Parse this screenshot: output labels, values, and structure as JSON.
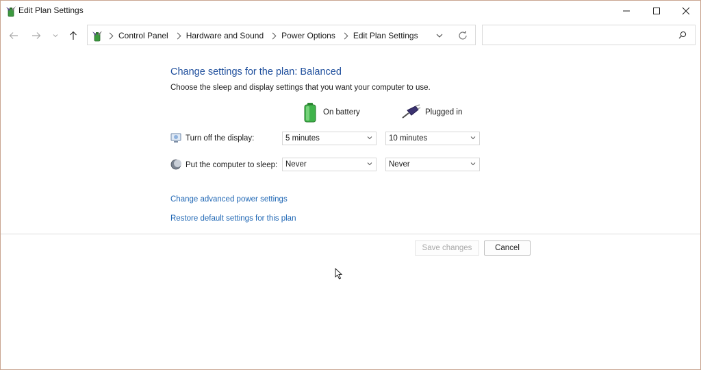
{
  "window": {
    "title": "Edit Plan Settings"
  },
  "address_bar": {
    "crumbs": [
      "Control Panel",
      "Hardware and Sound",
      "Power Options",
      "Edit Plan Settings"
    ]
  },
  "search": {
    "value": "",
    "placeholder": ""
  },
  "content": {
    "heading": "Change settings for the plan: Balanced",
    "subtext": "Choose the sleep and display settings that you want your computer to use.",
    "columns": {
      "battery": "On battery",
      "plugged": "Plugged in"
    },
    "rows": [
      {
        "label": "Turn off the display:",
        "battery": "5 minutes",
        "plugged": "10 minutes"
      },
      {
        "label": "Put the computer to sleep:",
        "battery": "Never",
        "plugged": "Never"
      }
    ],
    "links": {
      "advanced": "Change advanced power settings",
      "restore": "Restore default settings for this plan"
    }
  },
  "buttons": {
    "save": "Save changes",
    "cancel": "Cancel"
  },
  "colors": {
    "heading": "#1e4e9c",
    "link": "#1e66b4",
    "battery_green": "#3fb34a"
  }
}
